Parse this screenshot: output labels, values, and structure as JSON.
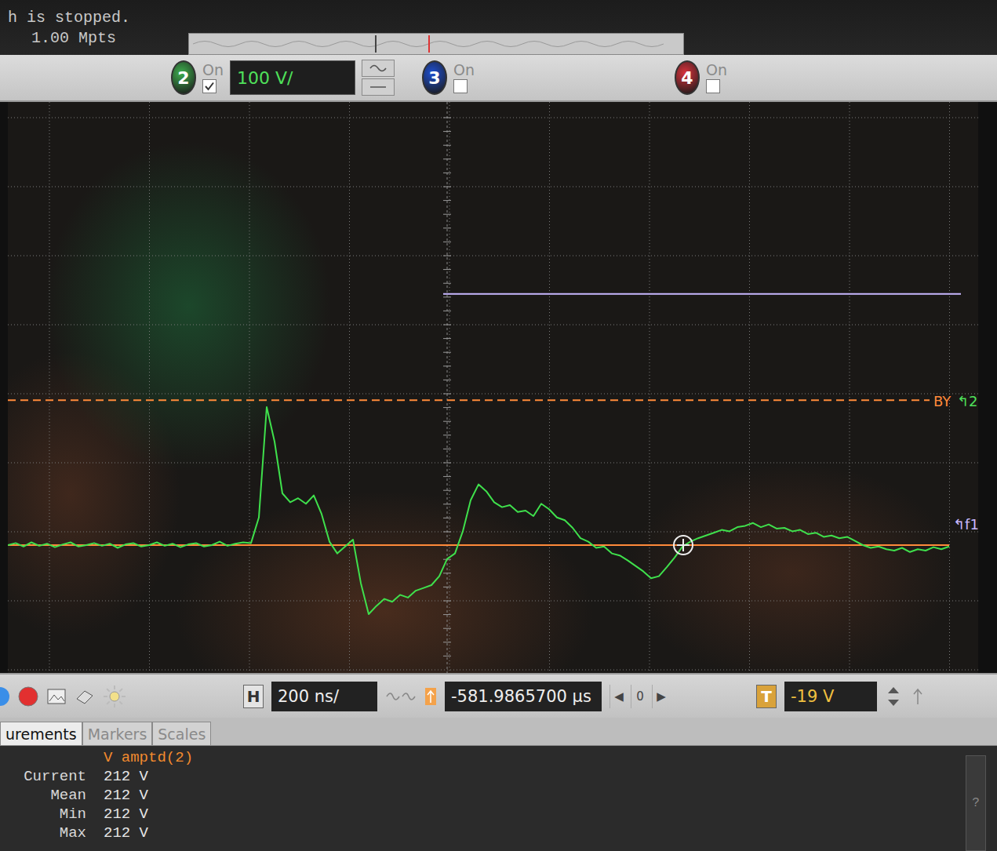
{
  "status": {
    "lines": [
      "h is stopped.",
      "1.00 Mpts"
    ]
  },
  "channels": [
    {
      "number": "2",
      "on_label": "On",
      "checked": true,
      "color": "#3fae4e",
      "scale": "100 V/"
    },
    {
      "number": "3",
      "on_label": "On",
      "checked": false,
      "color": "#1f4fd0"
    },
    {
      "number": "4",
      "on_label": "On",
      "checked": false,
      "color": "#d8323c"
    }
  ],
  "waveform": {
    "color": "#3fe04c",
    "volts_per_div": 100,
    "values": [
      0,
      3,
      -2,
      4,
      -1,
      2,
      -3,
      1,
      4,
      -2,
      0,
      3,
      -1,
      2,
      -4,
      1,
      3,
      -2,
      0,
      4,
      -1,
      2,
      -3,
      1,
      3,
      -2,
      0,
      5,
      -1,
      2,
      4,
      3,
      40,
      200,
      150,
      75,
      62,
      68,
      60,
      72,
      45,
      5,
      -12,
      -2,
      8,
      -55,
      -100,
      -88,
      -78,
      -82,
      -72,
      -76,
      -66,
      -62,
      -58,
      -45,
      -20,
      -12,
      20,
      65,
      88,
      78,
      62,
      55,
      58,
      48,
      50,
      42,
      60,
      52,
      40,
      36,
      25,
      10,
      5,
      -4,
      -2,
      -12,
      -15,
      -22,
      -30,
      -38,
      -48,
      -45,
      -32,
      -18,
      -2,
      5,
      10,
      14,
      18,
      22,
      20,
      26,
      28,
      32,
      26,
      30,
      24,
      25,
      20,
      22,
      16,
      18,
      12,
      14,
      10,
      12,
      6,
      0,
      -4,
      -2,
      -6,
      -8,
      -4,
      -10,
      -6,
      -8,
      -3,
      -6,
      -2
    ]
  },
  "trigger_line": {
    "volts": 210,
    "label": "BY",
    "channel_marker": "↰2"
  },
  "reference_line": {
    "volts": 364,
    "marker": "↰f1"
  },
  "horizontal": {
    "label": "H",
    "scale": "200 ns/",
    "position": "-581.9865700 µs",
    "nav": [
      "◀",
      "0",
      "▶"
    ]
  },
  "trigger": {
    "label": "T",
    "level": "-19 V"
  },
  "tabs": [
    {
      "label": "urements",
      "selected": true
    },
    {
      "label": "Markers",
      "selected": false
    },
    {
      "label": "Scales",
      "selected": false
    }
  ],
  "measurements": {
    "unit": "V",
    "name": "amptd(2)",
    "rows": [
      {
        "label": "Current",
        "value": "212 V"
      },
      {
        "label": "Mean",
        "value": "212 V"
      },
      {
        "label": "Min",
        "value": "212 V"
      },
      {
        "label": "Max",
        "value": "212 V"
      }
    ]
  },
  "help": "?"
}
